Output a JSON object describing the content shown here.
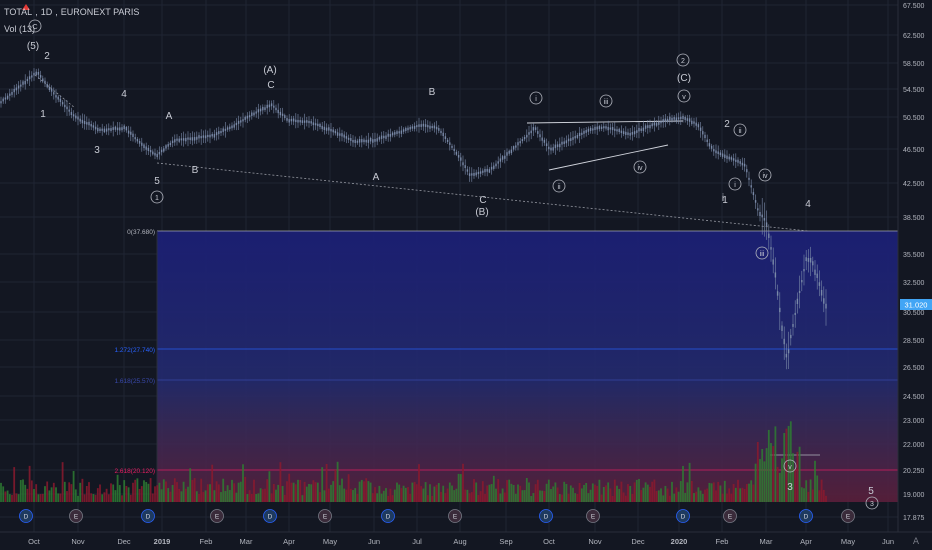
{
  "header": {
    "symbol": "TOTAL",
    "interval": "1D",
    "exchange": "EURONEXT PARIS",
    "volume_label": "Vol (13)"
  },
  "price_axis": {
    "labels": [
      "67.500",
      "62.500",
      "58.500",
      "54.500",
      "50.500",
      "46.500",
      "42.500",
      "38.500",
      "35.500",
      "32.500",
      "30.500",
      "28.500",
      "26.500",
      "24.500",
      "23.000",
      "22.000",
      "20.250",
      "19.000",
      "17.875"
    ],
    "current_price": "31.020",
    "current_price_color": "#42a5f5"
  },
  "time_axis": {
    "labels": [
      "Oct",
      "Nov",
      "Dec",
      "2019",
      "Feb",
      "Mar",
      "Apr",
      "May",
      "Jun",
      "Jul",
      "Aug",
      "Sep",
      "Oct",
      "Nov",
      "Dec",
      "2020",
      "Feb",
      "Mar",
      "Apr",
      "May",
      "Jun"
    ]
  },
  "fib_levels": [
    {
      "label": "0(37.680)",
      "color": "#b2b5be"
    },
    {
      "label": "1.272(27.740)",
      "color": "#2962ff"
    },
    {
      "label": "1.618(25.570)",
      "color": "#3949ab"
    },
    {
      "label": "2.618(20.120)",
      "color": "#e91e63"
    }
  ],
  "wave_labels": [
    "C",
    "(5)",
    "2",
    "1",
    "3",
    "4",
    "A",
    "B",
    "5",
    "1",
    "(A)",
    "C",
    "A",
    "B",
    "C",
    "(B)",
    "i",
    "iii",
    "ii",
    "iv",
    "i",
    "2",
    "(C)",
    "v",
    "2",
    "ii",
    "i",
    "1",
    "iv",
    "iii",
    "4",
    "v",
    "3",
    "5",
    "3"
  ],
  "event_markers": [
    "D",
    "E",
    "D",
    "E",
    "D",
    "E",
    "D",
    "E",
    "D",
    "E",
    "D",
    "E",
    "D",
    "E",
    "E"
  ],
  "colors": {
    "background": "#131722",
    "grid": "#1f2433",
    "candle": "#7a8aa8",
    "fib_zone_top": "#1a1f6e",
    "fib_zone_bottom": "#5a1f38",
    "volume_up": "#2e7d32",
    "volume_down": "#8b1a2e"
  }
}
